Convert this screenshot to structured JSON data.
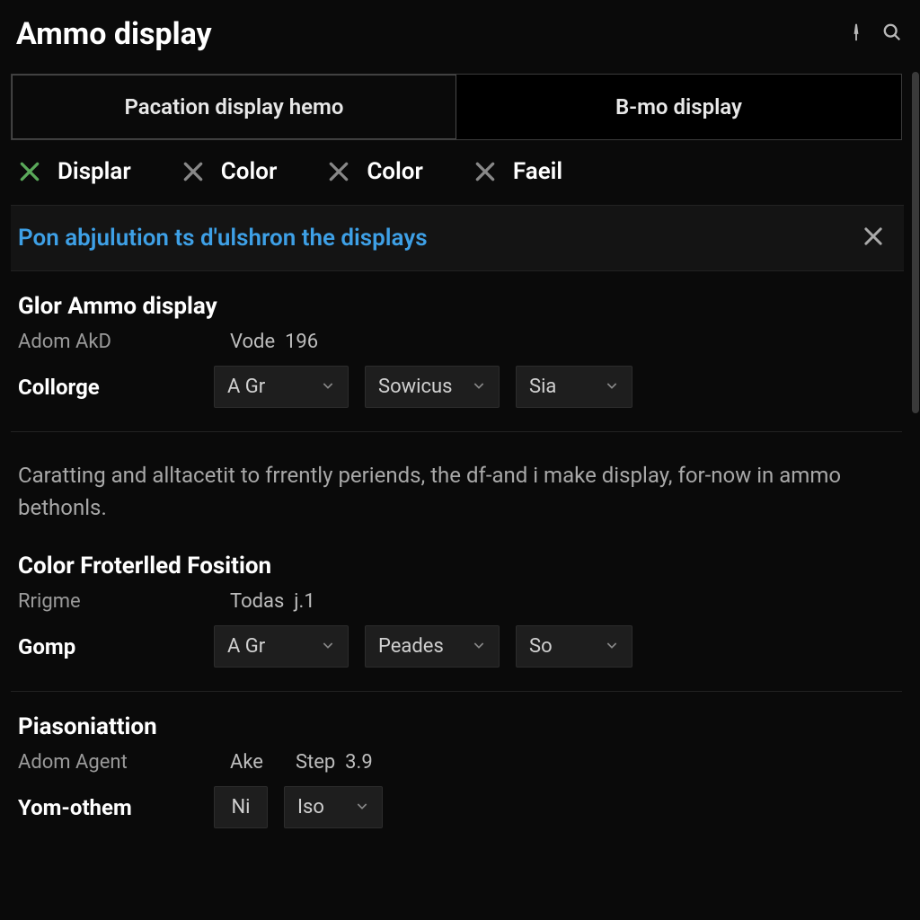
{
  "header": {
    "title": "Ammo display"
  },
  "tabs": [
    {
      "label": "Pacation display hemo",
      "active": true
    },
    {
      "label": "B-mo display",
      "active": false
    }
  ],
  "chips": [
    {
      "label": "Displar",
      "green": true
    },
    {
      "label": "Color",
      "green": false
    },
    {
      "label": "Color",
      "green": false
    },
    {
      "label": "Faeil",
      "green": false
    }
  ],
  "notice": {
    "text": "Pon abjulution ts d'ulshron the displays"
  },
  "section1": {
    "title": "Glor Ammo display",
    "meta_key": "Adom AkD",
    "meta_val_label": "Vode",
    "meta_val": "196",
    "field_label": "Collorge",
    "dropdowns": [
      "A Gr",
      "Sowicus",
      "Sia"
    ]
  },
  "description": "Caratting and alltacetit to frrently periends, the df-and i make display, for-now in ammo bethonls.",
  "section2": {
    "title": "Color Froterlled Fosition",
    "meta_key": "Rrigme",
    "meta_val_label": "Todas",
    "meta_val": "j.1",
    "field_label": "Gomp",
    "dropdowns": [
      "A Gr",
      "Peades",
      "So"
    ]
  },
  "section3": {
    "title": "Piasoniattion",
    "meta_key": "Adom Agent",
    "meta_val_label": "Ake",
    "meta_step_label": "Step",
    "meta_step_val": "3.9",
    "field_label": "Yom-othem",
    "input_val": "Ni",
    "dropdown": "Iso"
  }
}
